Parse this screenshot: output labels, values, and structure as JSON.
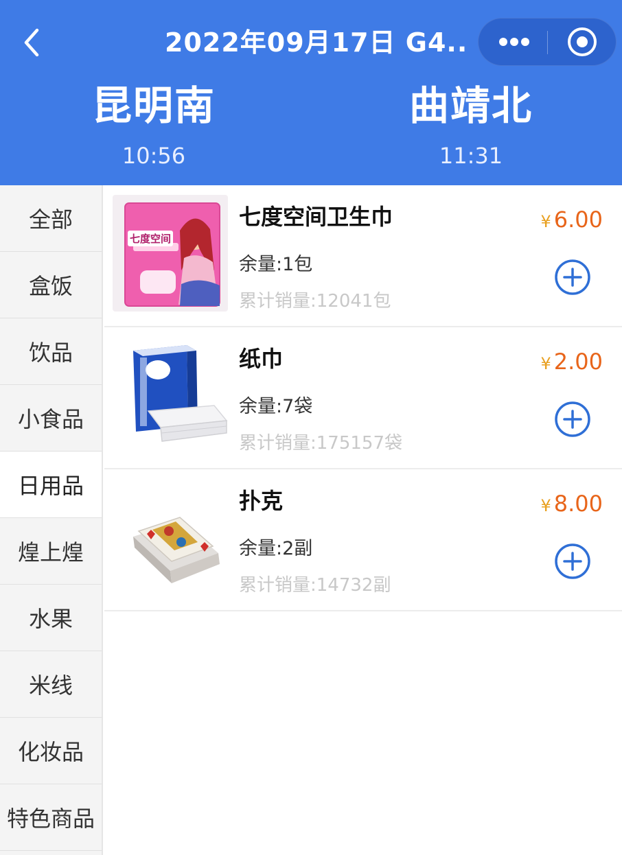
{
  "header": {
    "title": "2022年09月17日 G4...",
    "departure": {
      "station": "昆明南",
      "time": "10:56"
    },
    "arrival": {
      "station": "曲靖北",
      "time": "11:31"
    }
  },
  "sidebar": {
    "active_index": 4,
    "categories": [
      "全部",
      "盒饭",
      "饮品",
      "小食品",
      "日用品",
      "煌上煌",
      "水果",
      "米线",
      "化妆品",
      "特色商品"
    ]
  },
  "currency_symbol": "¥",
  "products": [
    {
      "name": "七度空间卫生巾",
      "price": "6.00",
      "stock": "余量:1包",
      "sales": "累计销量:12041包",
      "image_icon": "sanitary-pad-package-icon",
      "image_text": "七度空间"
    },
    {
      "name": "纸巾",
      "price": "2.00",
      "stock": "余量:7袋",
      "sales": "累计销量:175157袋",
      "image_icon": "tissue-pack-icon"
    },
    {
      "name": "扑克",
      "price": "8.00",
      "stock": "余量:2副",
      "sales": "累计销量:14732副",
      "image_icon": "playing-cards-icon"
    }
  ],
  "colors": {
    "header_bg": "#3f7be6",
    "price": "#e8651a",
    "add_button": "#2f6fd6",
    "sidebar_bg": "#f4f4f4"
  }
}
